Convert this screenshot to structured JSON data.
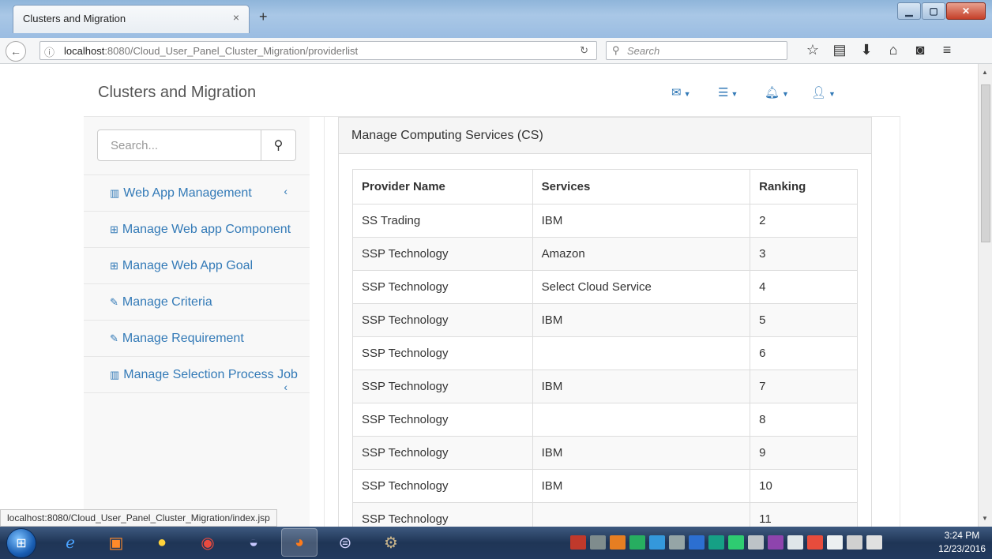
{
  "browser": {
    "tab_title": "Clusters and Migration",
    "tab_close": "×",
    "new_tab": "+",
    "url_host": "localhost",
    "url_rest": ":8080/Cloud_User_Panel_Cluster_Migration/providerlist",
    "search_placeholder": "Search",
    "icons": [
      "info-icon",
      "reload-icon",
      "search-icon",
      "star-icon",
      "reading-list-icon",
      "download-icon",
      "home-icon",
      "pocket-icon",
      "menu-icon"
    ]
  },
  "header": {
    "brand": "Clusters and Migration",
    "icons": [
      "envelope-icon",
      "tasks-icon",
      "bell-icon",
      "user-icon"
    ]
  },
  "sidebar": {
    "search_placeholder": "Search...",
    "items": [
      {
        "label": "Web App Management",
        "icon": "bar-chart-icon"
      },
      {
        "label": "Manage Web app Component",
        "icon": "table-icon"
      },
      {
        "label": "Manage Web App Goal",
        "icon": "table-icon"
      },
      {
        "label": "Manage Criteria",
        "icon": "edit-icon"
      },
      {
        "label": "Manage Requirement",
        "icon": "edit-icon"
      },
      {
        "label": "Manage Selection Process Job",
        "icon": "bar-chart-icon"
      }
    ]
  },
  "panel": {
    "heading": "Manage Computing Services (CS)",
    "columns": [
      "Provider Name",
      "Services",
      "Ranking"
    ],
    "rows": [
      [
        "SS Trading",
        "IBM",
        "2"
      ],
      [
        "SSP Technology",
        "Amazon",
        "3"
      ],
      [
        "SSP Technology",
        "Select Cloud Service",
        "4"
      ],
      [
        "SSP Technology",
        "IBM",
        "5"
      ],
      [
        "SSP Technology",
        "",
        "6"
      ],
      [
        "SSP Technology",
        "IBM",
        "7"
      ],
      [
        "SSP Technology",
        "",
        "8"
      ],
      [
        "SSP Technology",
        "IBM",
        "9"
      ],
      [
        "SSP Technology",
        "IBM",
        "10"
      ],
      [
        "SSP Technology",
        "",
        "11"
      ]
    ]
  },
  "status_bar": "localhost:8080/Cloud_User_Panel_Cluster_Migration/index.jsp",
  "taskbar": {
    "time": "3:24 PM",
    "date": "12/23/2016"
  }
}
